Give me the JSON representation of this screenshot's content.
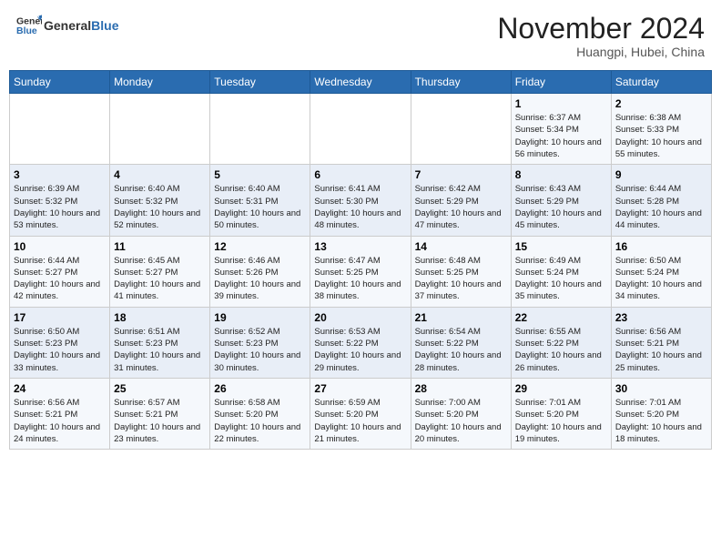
{
  "header": {
    "logo_general": "General",
    "logo_blue": "Blue",
    "month_title": "November 2024",
    "subtitle": "Huangpi, Hubei, China"
  },
  "days_of_week": [
    "Sunday",
    "Monday",
    "Tuesday",
    "Wednesday",
    "Thursday",
    "Friday",
    "Saturday"
  ],
  "weeks": [
    [
      {
        "day": "",
        "info": ""
      },
      {
        "day": "",
        "info": ""
      },
      {
        "day": "",
        "info": ""
      },
      {
        "day": "",
        "info": ""
      },
      {
        "day": "",
        "info": ""
      },
      {
        "day": "1",
        "info": "Sunrise: 6:37 AM\nSunset: 5:34 PM\nDaylight: 10 hours and 56 minutes."
      },
      {
        "day": "2",
        "info": "Sunrise: 6:38 AM\nSunset: 5:33 PM\nDaylight: 10 hours and 55 minutes."
      }
    ],
    [
      {
        "day": "3",
        "info": "Sunrise: 6:39 AM\nSunset: 5:32 PM\nDaylight: 10 hours and 53 minutes."
      },
      {
        "day": "4",
        "info": "Sunrise: 6:40 AM\nSunset: 5:32 PM\nDaylight: 10 hours and 52 minutes."
      },
      {
        "day": "5",
        "info": "Sunrise: 6:40 AM\nSunset: 5:31 PM\nDaylight: 10 hours and 50 minutes."
      },
      {
        "day": "6",
        "info": "Sunrise: 6:41 AM\nSunset: 5:30 PM\nDaylight: 10 hours and 48 minutes."
      },
      {
        "day": "7",
        "info": "Sunrise: 6:42 AM\nSunset: 5:29 PM\nDaylight: 10 hours and 47 minutes."
      },
      {
        "day": "8",
        "info": "Sunrise: 6:43 AM\nSunset: 5:29 PM\nDaylight: 10 hours and 45 minutes."
      },
      {
        "day": "9",
        "info": "Sunrise: 6:44 AM\nSunset: 5:28 PM\nDaylight: 10 hours and 44 minutes."
      }
    ],
    [
      {
        "day": "10",
        "info": "Sunrise: 6:44 AM\nSunset: 5:27 PM\nDaylight: 10 hours and 42 minutes."
      },
      {
        "day": "11",
        "info": "Sunrise: 6:45 AM\nSunset: 5:27 PM\nDaylight: 10 hours and 41 minutes."
      },
      {
        "day": "12",
        "info": "Sunrise: 6:46 AM\nSunset: 5:26 PM\nDaylight: 10 hours and 39 minutes."
      },
      {
        "day": "13",
        "info": "Sunrise: 6:47 AM\nSunset: 5:25 PM\nDaylight: 10 hours and 38 minutes."
      },
      {
        "day": "14",
        "info": "Sunrise: 6:48 AM\nSunset: 5:25 PM\nDaylight: 10 hours and 37 minutes."
      },
      {
        "day": "15",
        "info": "Sunrise: 6:49 AM\nSunset: 5:24 PM\nDaylight: 10 hours and 35 minutes."
      },
      {
        "day": "16",
        "info": "Sunrise: 6:50 AM\nSunset: 5:24 PM\nDaylight: 10 hours and 34 minutes."
      }
    ],
    [
      {
        "day": "17",
        "info": "Sunrise: 6:50 AM\nSunset: 5:23 PM\nDaylight: 10 hours and 33 minutes."
      },
      {
        "day": "18",
        "info": "Sunrise: 6:51 AM\nSunset: 5:23 PM\nDaylight: 10 hours and 31 minutes."
      },
      {
        "day": "19",
        "info": "Sunrise: 6:52 AM\nSunset: 5:23 PM\nDaylight: 10 hours and 30 minutes."
      },
      {
        "day": "20",
        "info": "Sunrise: 6:53 AM\nSunset: 5:22 PM\nDaylight: 10 hours and 29 minutes."
      },
      {
        "day": "21",
        "info": "Sunrise: 6:54 AM\nSunset: 5:22 PM\nDaylight: 10 hours and 28 minutes."
      },
      {
        "day": "22",
        "info": "Sunrise: 6:55 AM\nSunset: 5:22 PM\nDaylight: 10 hours and 26 minutes."
      },
      {
        "day": "23",
        "info": "Sunrise: 6:56 AM\nSunset: 5:21 PM\nDaylight: 10 hours and 25 minutes."
      }
    ],
    [
      {
        "day": "24",
        "info": "Sunrise: 6:56 AM\nSunset: 5:21 PM\nDaylight: 10 hours and 24 minutes."
      },
      {
        "day": "25",
        "info": "Sunrise: 6:57 AM\nSunset: 5:21 PM\nDaylight: 10 hours and 23 minutes."
      },
      {
        "day": "26",
        "info": "Sunrise: 6:58 AM\nSunset: 5:20 PM\nDaylight: 10 hours and 22 minutes."
      },
      {
        "day": "27",
        "info": "Sunrise: 6:59 AM\nSunset: 5:20 PM\nDaylight: 10 hours and 21 minutes."
      },
      {
        "day": "28",
        "info": "Sunrise: 7:00 AM\nSunset: 5:20 PM\nDaylight: 10 hours and 20 minutes."
      },
      {
        "day": "29",
        "info": "Sunrise: 7:01 AM\nSunset: 5:20 PM\nDaylight: 10 hours and 19 minutes."
      },
      {
        "day": "30",
        "info": "Sunrise: 7:01 AM\nSunset: 5:20 PM\nDaylight: 10 hours and 18 minutes."
      }
    ]
  ]
}
